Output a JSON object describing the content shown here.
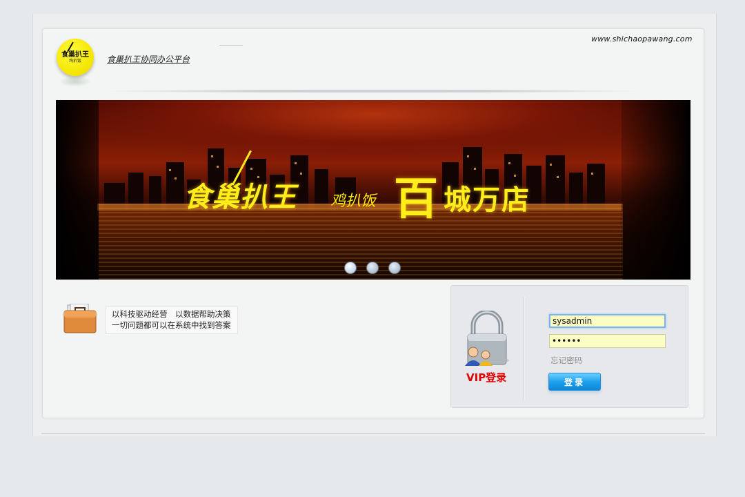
{
  "header": {
    "logo": {
      "line1": "食巢扒王",
      "line2": "鸡扒饭"
    },
    "platform_title": "食巢扒王协同办公平台",
    "site_url": "www.shichaopawang.com"
  },
  "banner": {
    "brand_main": "食巢扒王",
    "brand_sub": "鸡扒饭",
    "slogan_first": "百",
    "slogan_rest": "城万店",
    "slide_count": 3,
    "active_slide": 1
  },
  "promo": {
    "line1": "以科技驱动经营　以数据帮助决策",
    "line2": "一切问题都可以在系统中找到答案"
  },
  "login": {
    "vip_label": "VIP登录",
    "username_value": "sysadmin",
    "password_value": "••••••",
    "forgot_password": "忘记密码",
    "submit_label": "登录"
  },
  "colors": {
    "accent_blue": "#1fa0ee",
    "vip_red": "#e10000",
    "input_yellow": "#fbfdc4",
    "brand_yellow": "#ffee1a"
  }
}
